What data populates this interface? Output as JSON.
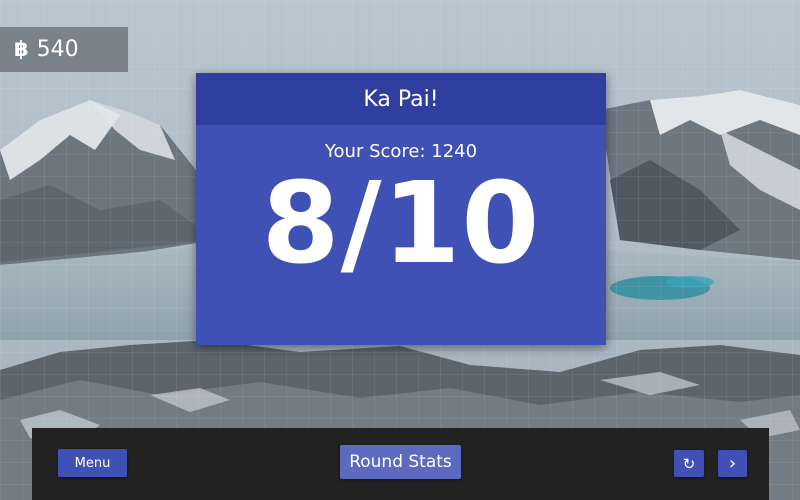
{
  "hud": {
    "coin_icon": "฿",
    "coin_value": "540"
  },
  "result": {
    "title": "Ka Pai!",
    "score_line": "Your Score: 1240",
    "big_score": "8/10"
  },
  "bottom_bar": {
    "menu_label": "Menu",
    "round_stats_label": "Round Stats",
    "retry_icon": "↻",
    "next_icon": "›"
  },
  "colors": {
    "card": "#3f51b5",
    "card_header": "#303f9f",
    "bottom_bar": "#222222",
    "button": "#3f51b5",
    "round_stats_button": "#5c6bc0"
  }
}
